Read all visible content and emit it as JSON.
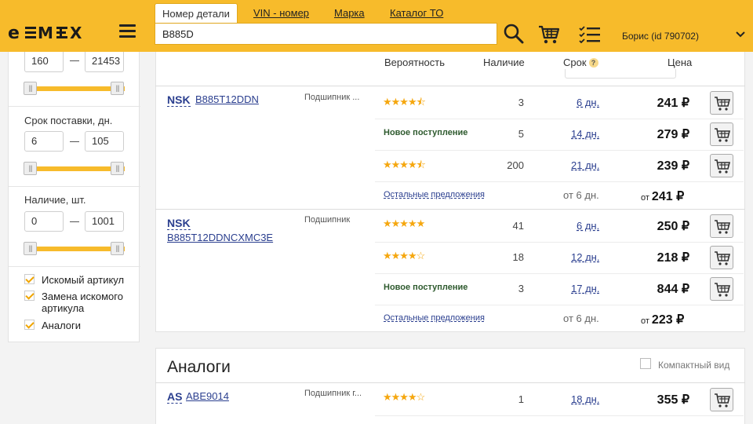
{
  "header": {
    "logo": "EMEX",
    "tabs": [
      {
        "label": "Номер детали"
      },
      {
        "label": "VIN - номер"
      },
      {
        "label": "Марка"
      },
      {
        "label": "Каталог ТО"
      }
    ],
    "search_value": "B885D",
    "user": "Борис  (id 790702)",
    "accent_color": "#f7bb2b"
  },
  "sidebar": {
    "price": {
      "min": "160",
      "max": "21453"
    },
    "delivery": {
      "title": "Срок поставки, дн.",
      "min": "6",
      "max": "105"
    },
    "stock": {
      "title": "Наличие, шт.",
      "min": "0",
      "max": "1001"
    },
    "checks": [
      {
        "label": "Искомый артикул",
        "checked": true
      },
      {
        "label": "Замена искомого артикула",
        "checked": true
      },
      {
        "label": "Аналоги",
        "checked": true
      }
    ]
  },
  "columns": {
    "probability": "Вероятность",
    "stock": "Наличие",
    "term": "Срок",
    "term_hint": "?",
    "price": "Цена"
  },
  "groups": [
    {
      "brand": "NSK",
      "part": "B885T12DDN",
      "desc": "Подшипник ...",
      "offers": [
        {
          "stars": "★★★★⯪",
          "stock": "3",
          "days": "6 дн.",
          "price": "241 ₽"
        },
        {
          "status": "Новое поступление",
          "stock": "5",
          "days": "14 дн.",
          "price": "279 ₽"
        },
        {
          "stars": "★★★★⯪",
          "stock": "200",
          "days": "21 дн.",
          "price": "239 ₽"
        }
      ],
      "others_link": "Остальные предложения",
      "from_days": "от 6 дн.",
      "from_prefix": "от",
      "from_price": "241 ₽"
    },
    {
      "brand": "NSK",
      "part": "B885T12DDNCXMC3E",
      "desc": "Подшипник",
      "offers": [
        {
          "stars": "★★★★★",
          "stock": "41",
          "days": "6 дн.",
          "price": "250 ₽"
        },
        {
          "stars": "★★★★☆",
          "stock": "18",
          "days": "12 дн.",
          "price": "218 ₽"
        },
        {
          "status": "Новое поступление",
          "stock": "3",
          "days": "17 дн.",
          "price": "844 ₽"
        }
      ],
      "others_link": "Остальные предложения",
      "from_days": "от 6 дн.",
      "from_prefix": "от",
      "from_price": "223 ₽"
    }
  ],
  "analogs": {
    "title": "Аналоги",
    "compact_label": "Компактный вид",
    "rows": [
      {
        "brand": "AS",
        "part": "ABE9014",
        "desc": "Подшипник г...",
        "stars": "★★★★☆",
        "stock": "1",
        "days": "18 дн.",
        "price": "355 ₽"
      }
    ]
  }
}
